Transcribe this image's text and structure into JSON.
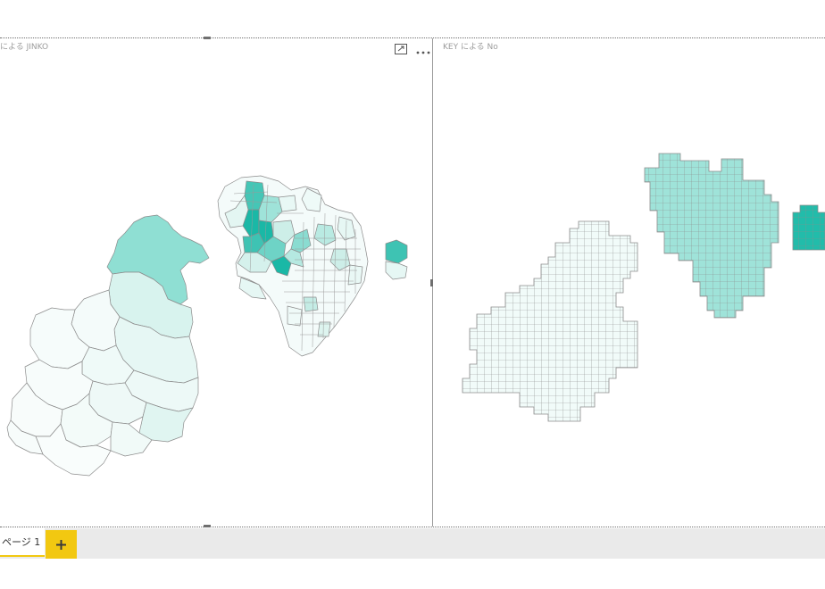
{
  "visuals": {
    "left": {
      "title": "による JINKO",
      "header_icons": [
        "focus-mode-icon",
        "more-options-icon"
      ]
    },
    "right": {
      "title": "KEY による No"
    }
  },
  "pages": {
    "tabs": [
      {
        "label": "ページ 1",
        "active": true
      }
    ],
    "add_icon": "plus-icon"
  },
  "colors": {
    "accent": "#f2c811",
    "fill_dark": "#1ab8a6",
    "fill_light": "#f1fbf9",
    "region_stroke": "#8c8c8c",
    "title_text": "#9c9c9c"
  }
}
